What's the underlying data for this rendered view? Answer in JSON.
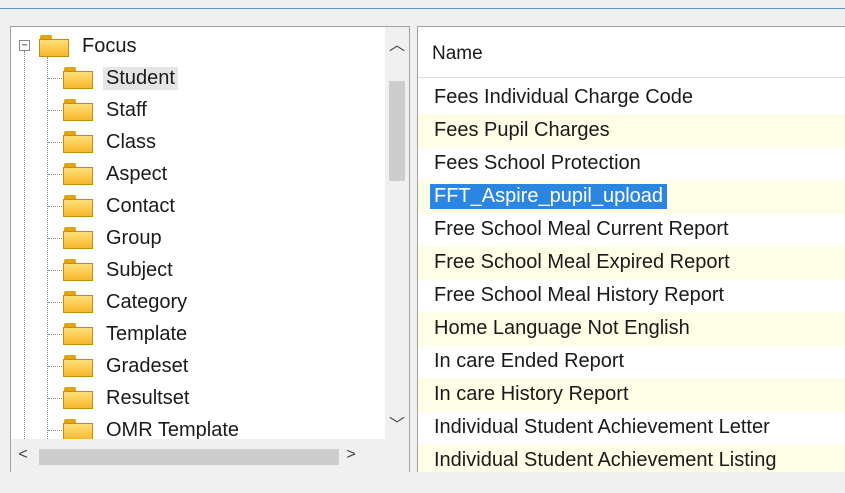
{
  "tree": {
    "root": {
      "label": "Focus",
      "expander": "−",
      "icon": "folder-icon"
    },
    "items": [
      {
        "label": "Student",
        "selected": true
      },
      {
        "label": "Staff"
      },
      {
        "label": "Class"
      },
      {
        "label": "Aspect"
      },
      {
        "label": "Contact"
      },
      {
        "label": "Group"
      },
      {
        "label": "Subject"
      },
      {
        "label": "Category"
      },
      {
        "label": "Template"
      },
      {
        "label": "Gradeset"
      },
      {
        "label": "Resultset"
      },
      {
        "label": "OMR Template"
      }
    ],
    "scroll_up": "︿",
    "scroll_down": "﹀",
    "scroll_left": "<",
    "scroll_right": ">"
  },
  "list": {
    "header": "Name",
    "rows": [
      {
        "label": "Fees Individual Charge Code"
      },
      {
        "label": "Fees Pupil Charges"
      },
      {
        "label": "Fees School Protection"
      },
      {
        "label": "FFT_Aspire_pupil_upload",
        "selected": true
      },
      {
        "label": "Free School Meal Current Report"
      },
      {
        "label": "Free School Meal Expired Report"
      },
      {
        "label": "Free School Meal History Report"
      },
      {
        "label": "Home Language Not English"
      },
      {
        "label": "In care Ended Report"
      },
      {
        "label": "In care History Report"
      },
      {
        "label": "Individual Student Achievement Letter"
      },
      {
        "label": "Individual Student Achievement Listing"
      }
    ]
  },
  "colors": {
    "selection": "#2a86e0",
    "alt_row": "#fefde6",
    "folder": "#f6b62b"
  }
}
